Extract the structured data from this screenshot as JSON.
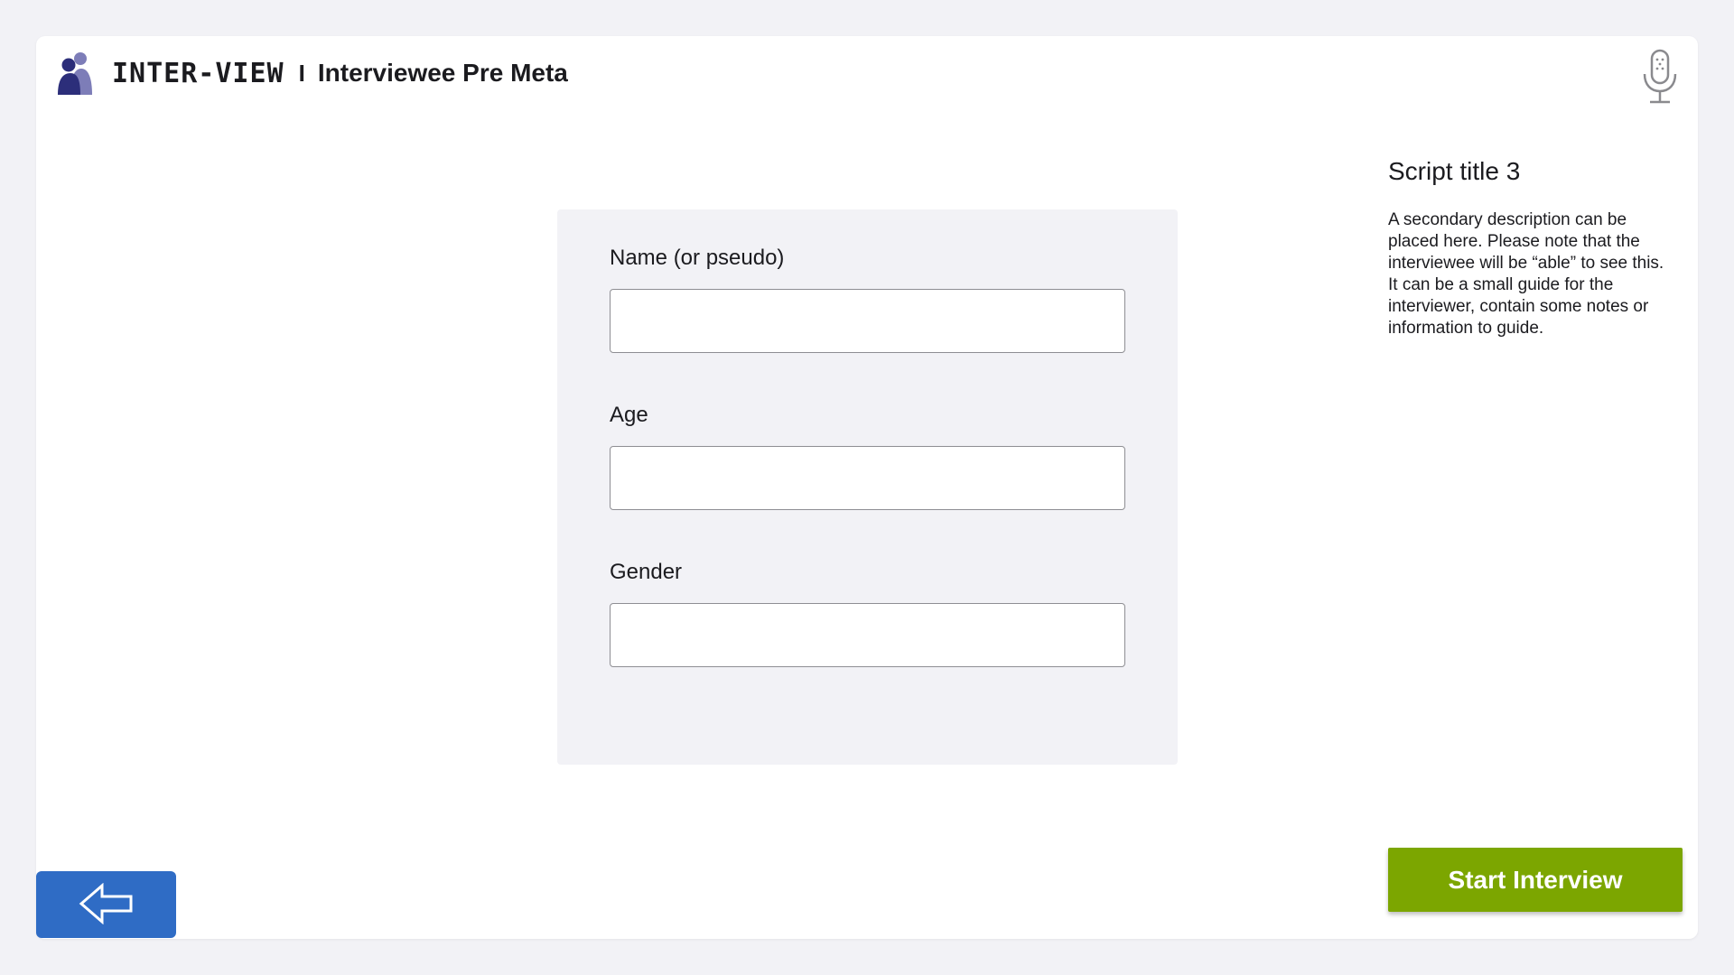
{
  "header": {
    "brand_name": "INTER-VIEW",
    "separator": "I",
    "page_title": "Interviewee Pre Meta",
    "logo_icon": "people-logo-icon",
    "mic_icon": "microphone-icon"
  },
  "form": {
    "fields": [
      {
        "label": "Name (or pseudo)",
        "value": ""
      },
      {
        "label": "Age",
        "value": ""
      },
      {
        "label": "Gender",
        "value": ""
      }
    ]
  },
  "script": {
    "title": "Script title 3",
    "description": "A secondary description can be placed here. Please note that the interviewee will be “able” to see this. It can be a small guide for the interviewer, contain some notes or information to guide."
  },
  "footer": {
    "back_icon": "arrow-left-icon",
    "start_label": "Start Interview"
  },
  "colors": {
    "background": "#f2f2f6",
    "back_button": "#2f6cc5",
    "start_button": "#7ca600",
    "logo_dark": "#2c2e7a",
    "logo_light": "#7d7db8"
  }
}
